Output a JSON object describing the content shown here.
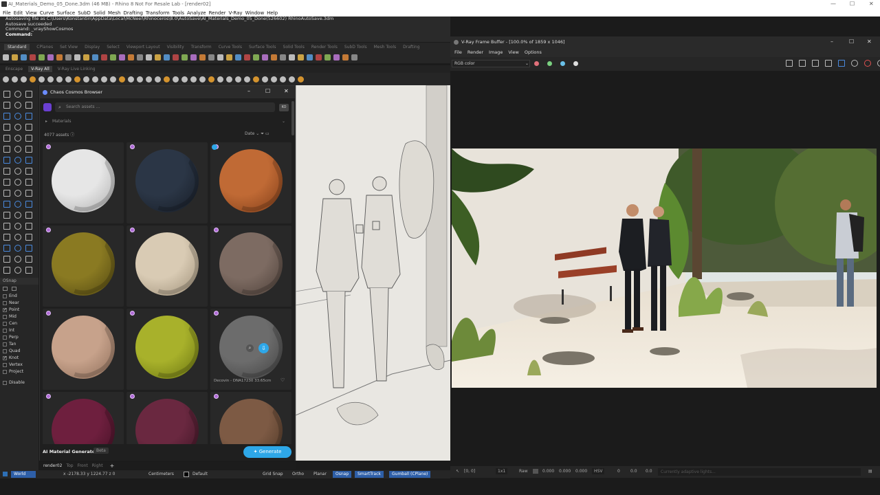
{
  "app": {
    "title": "AI_Materials_Demo_05_Done.3dm (46 MB) - Rhino 8 Not For Resale Lab - [render02]"
  },
  "menu": [
    "File",
    "Edit",
    "View",
    "Curve",
    "Surface",
    "SubD",
    "Solid",
    "Mesh",
    "Drafting",
    "Transform",
    "Tools",
    "Analyze",
    "Render",
    "V-Ray",
    "Window",
    "Help"
  ],
  "command": {
    "lines": [
      "Autosaving file as C:\\Users\\Konstantin\\AppData\\Local\\McNeel\\Rhinoceros\\8.0\\AutoSave\\AI_Materials_Demo_05_Done(526602) RhinoAutoSave.3dm",
      "Autosave succeeded",
      "Command: _vrayShowCosmos",
      "Command:"
    ]
  },
  "toolbar_tabs": [
    "Standard",
    "CPlanes",
    "Set View",
    "Display",
    "Select",
    "Viewport Layout",
    "Visibility",
    "Transform",
    "Curve Tools",
    "Surface Tools",
    "Solid Tools",
    "Render Tools",
    "SubD Tools",
    "Mesh Tools",
    "Drafting"
  ],
  "vray_tabs": [
    "Enscape",
    "V-Ray All",
    "V-Ray Live Linking"
  ],
  "osnap": {
    "header": "OSnap",
    "items": [
      {
        "label": "End",
        "checked": false
      },
      {
        "label": "Near",
        "checked": false
      },
      {
        "label": "Point",
        "checked": true
      },
      {
        "label": "Mid",
        "checked": false
      },
      {
        "label": "Cen",
        "checked": false
      },
      {
        "label": "Int",
        "checked": false
      },
      {
        "label": "Perp",
        "checked": false
      },
      {
        "label": "Tan",
        "checked": false
      },
      {
        "label": "Quad",
        "checked": false
      },
      {
        "label": "Knot",
        "checked": true
      },
      {
        "label": "Vertex",
        "checked": false
      },
      {
        "label": "Project",
        "checked": false
      }
    ],
    "disable": "Disable"
  },
  "cosmos": {
    "title": "Chaos Cosmos Browser",
    "search_placeholder": "Search assets ...",
    "user_initials": "KO",
    "category": "Materials",
    "asset_count": "4077 assets",
    "sort": "Date",
    "tiles": [
      {
        "color": "#e6e6e6",
        "shade": "#a9a9a9"
      },
      {
        "color": "#2b3646",
        "shade": "#151b24"
      },
      {
        "color": "#c06a35",
        "shade": "#7d3b17"
      },
      {
        "color": "#8a7a22",
        "shade": "#4e4410"
      },
      {
        "color": "#d9cbb4",
        "shade": "#9a8b74"
      },
      {
        "color": "#7d6b62",
        "shade": "#4a3d36"
      },
      {
        "color": "#c7a28b",
        "shade": "#8a6a56"
      },
      {
        "color": "#a8b12b",
        "shade": "#66700f"
      },
      {
        "color": "#6c6c6c",
        "shade": "#3f3f3f"
      },
      {
        "color": "#6e1f3e",
        "shade": "#3e0f22"
      },
      {
        "color": "#6a2840",
        "shade": "#3a1422"
      },
      {
        "color": "#7d5a44",
        "shade": "#4a3424"
      }
    ],
    "hover_caption": "Decovin - DNA17230 33.65cm",
    "ai_label": "AI Material Generator",
    "beta": "Beta",
    "generate": "Generate"
  },
  "viewport_tabs": [
    "render02",
    "Top",
    "Front",
    "Right"
  ],
  "vfb": {
    "title": "V-Ray Frame Buffer - [100.0% of 1859 x 1046]",
    "menu": [
      "File",
      "Render",
      "Image",
      "View",
      "Options"
    ],
    "channel": "RGB color",
    "status": {
      "coords": "[0, 0]",
      "zoom": "1x1",
      "mode": "Raw",
      "r": "0.000",
      "g": "0.000",
      "b": "0.000",
      "space": "HSV",
      "h": "0",
      "s": "0.0",
      "v": "0.0",
      "message": "Currently adaptive lights..."
    }
  },
  "statusbar": {
    "cplane": "World",
    "coords": "x -2178.33  y 1224.77  z 0",
    "units": "Centimeters",
    "layer": "Default",
    "grid_snap": "Grid Snap",
    "ortho": "Ortho",
    "planar": "Planar",
    "osnap": "Osnap",
    "smarttrack": "SmartTrack",
    "gumball": "Gumball (CPlane)"
  }
}
